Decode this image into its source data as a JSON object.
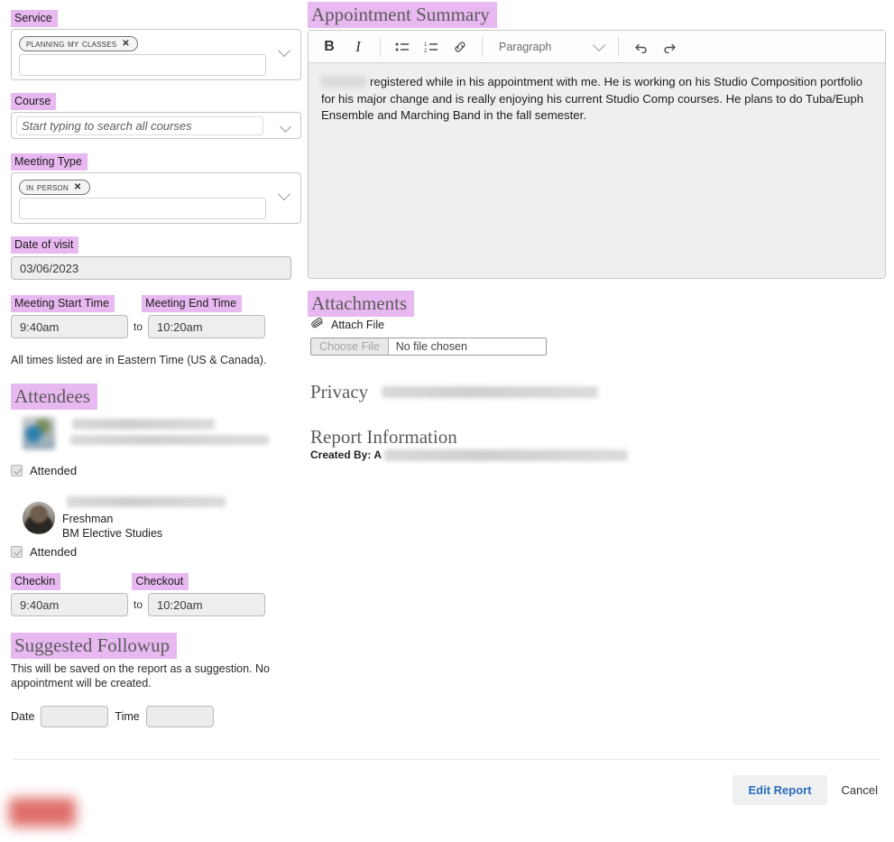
{
  "left": {
    "service": {
      "label": "Service",
      "tokens": [
        {
          "text": "Planning My Classes",
          "remove_icon": "close-icon"
        }
      ],
      "caret_icon": "chevron-down-icon"
    },
    "course": {
      "label": "Course",
      "placeholder": "Start typing to search all courses",
      "value": "",
      "caret_icon": "chevron-down-icon"
    },
    "meeting_type": {
      "label": "Meeting Type",
      "tokens": [
        {
          "text": "In Person",
          "remove_icon": "close-icon"
        }
      ],
      "caret_icon": "chevron-down-icon"
    },
    "date_of_visit": {
      "label": "Date of visit",
      "value": "03/06/2023"
    },
    "meeting_times": {
      "start_label": "Meeting Start Time",
      "end_label": "Meeting End Time",
      "start_value": "9:40am",
      "end_value": "10:20am",
      "separator": "to"
    },
    "timezone_note": "All times listed are in Eastern Time (US & Canada).",
    "attendees": {
      "heading": "Attendees",
      "list": [
        {
          "name_redacted": true,
          "meta_redacted": true,
          "avatar_icon": "avatar",
          "attended_label": "Attended",
          "attended_checked": true
        },
        {
          "name_redacted": true,
          "meta_line_1": "Freshman",
          "meta_line_2": "BM Elective Studies",
          "avatar_icon": "avatar",
          "attended_label": "Attended",
          "attended_checked": true
        }
      ],
      "checkin_label": "Checkin",
      "checkout_label": "Checkout",
      "checkin_value": "9:40am",
      "checkout_value": "10:20am",
      "separator": "to"
    },
    "followup": {
      "heading": "Suggested Followup",
      "note": "This will be saved on the report as a suggestion. No appointment will be created.",
      "date_label": "Date",
      "date_value": "",
      "time_label": "Time",
      "time_value": ""
    }
  },
  "right": {
    "summary": {
      "heading": "Appointment Summary",
      "toolbar": {
        "bold": "B",
        "italic": "I",
        "bullet_list_icon": "bullet-list-icon",
        "numbered_list_icon": "numbered-list-icon",
        "link_icon": "link-icon",
        "format_value": "Paragraph",
        "format_caret_icon": "chevron-down-icon",
        "undo_icon": "undo-icon",
        "redo_icon": "redo-icon"
      },
      "body_text": "registered while in his appointment with me. He is working on his Studio Composition portfolio for his major change and is really enjoying his current Studio Comp courses. He plans to do Tuba/Euph Ensemble and Marching Band in the fall semester.",
      "body_name_redacted": true
    },
    "attachments": {
      "heading": "Attachments",
      "attach_label": "Attach File",
      "attach_icon": "paperclip-icon",
      "choose_button": "Choose File",
      "file_status": "No file chosen"
    },
    "privacy": {
      "heading": "Privacy",
      "content_redacted": true
    },
    "report_information": {
      "heading": "Report Information",
      "created_by_label": "Created By:",
      "created_by_prefix": "A",
      "created_by_redacted": true
    }
  },
  "footer": {
    "edit_label": "Edit Report",
    "cancel_label": "Cancel"
  },
  "colors": {
    "highlight": "#e8b8f0",
    "link_blue": "#2a6ebb",
    "danger": "#d9534f"
  }
}
